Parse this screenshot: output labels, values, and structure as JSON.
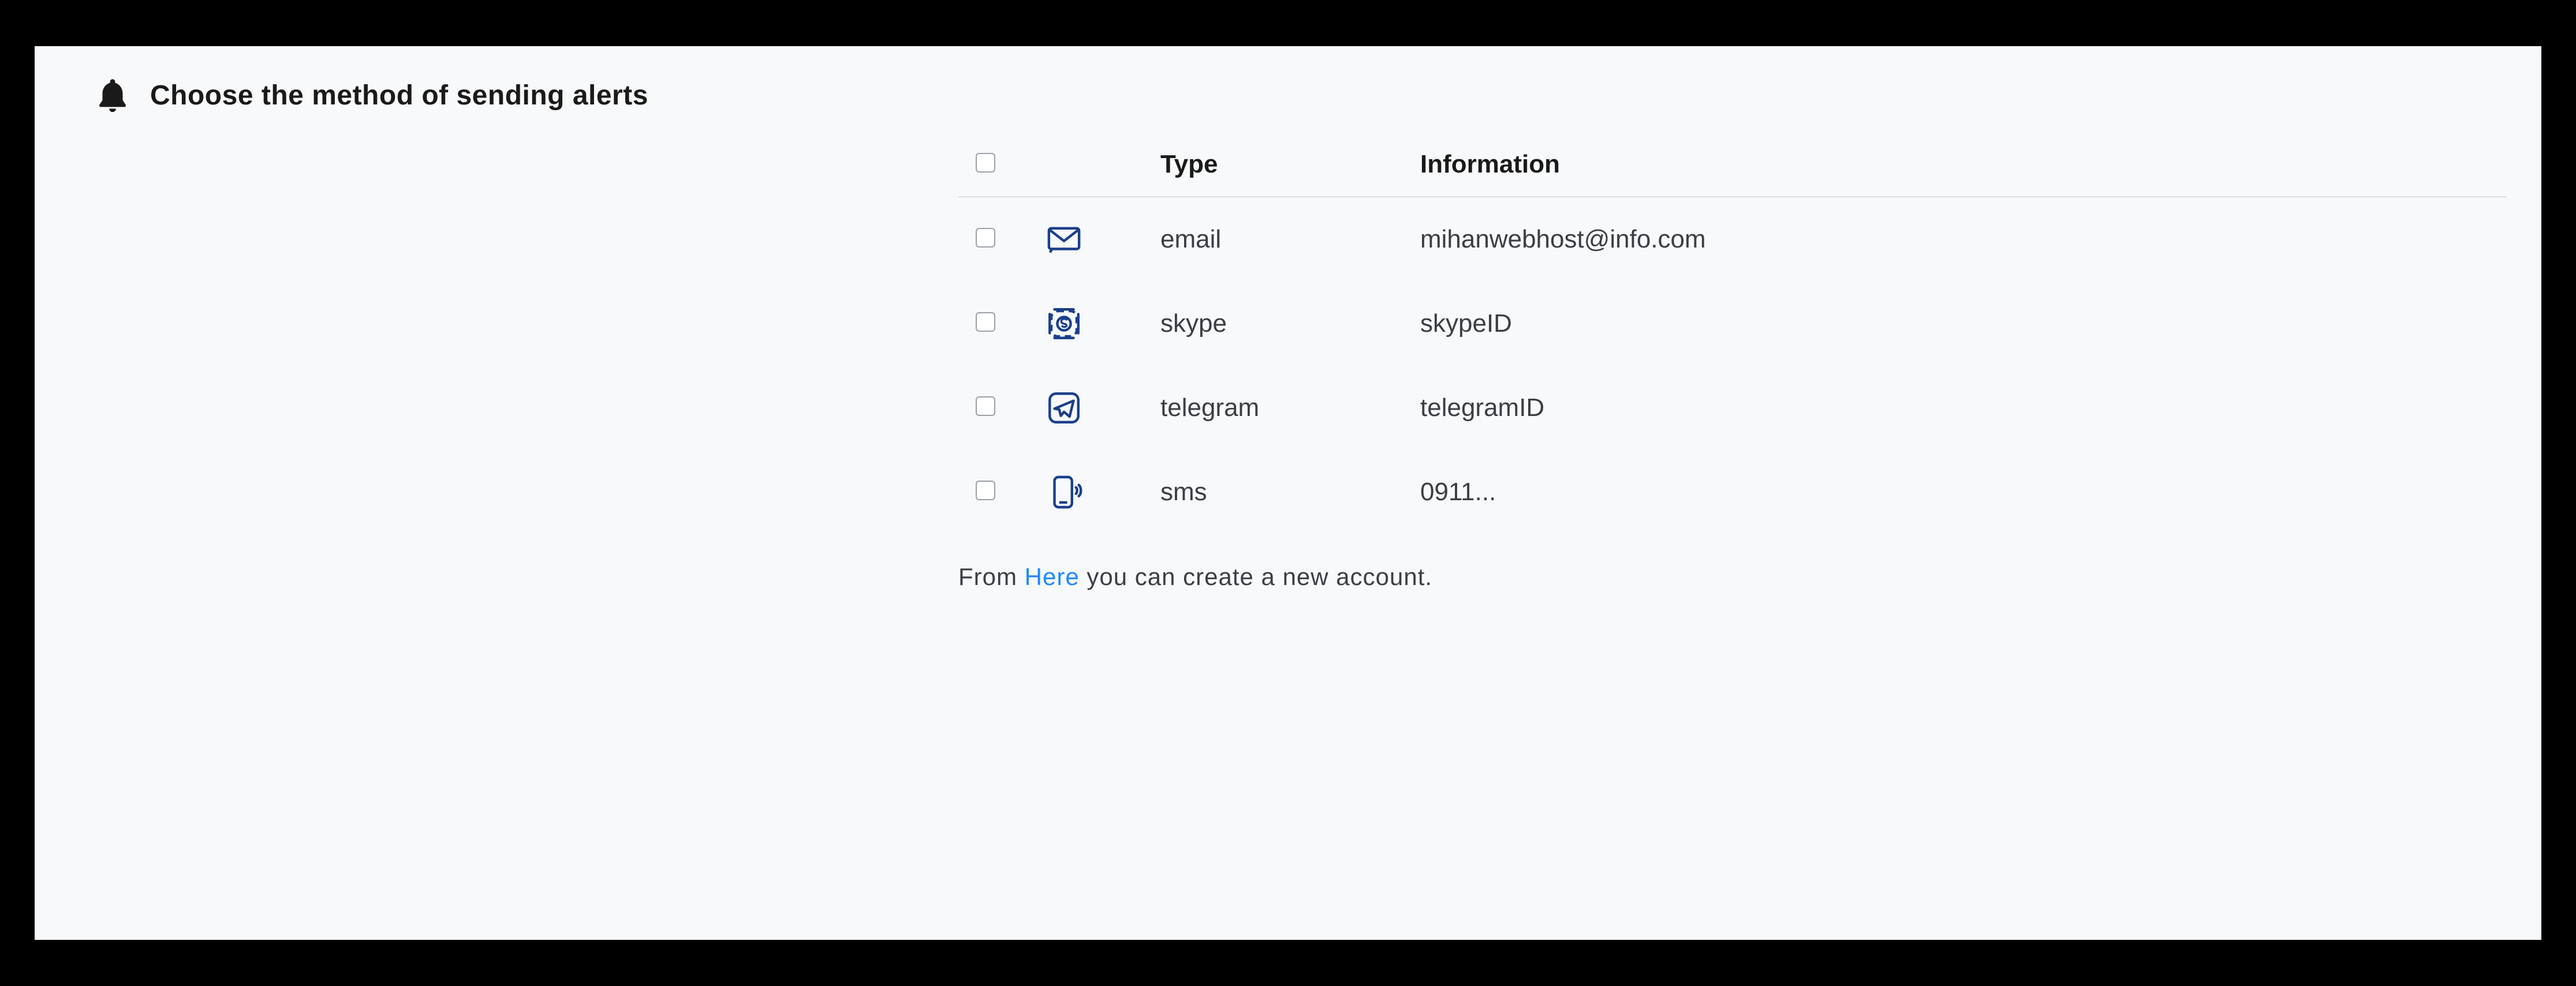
{
  "header": {
    "title": "Choose the method of sending alerts"
  },
  "table": {
    "headers": {
      "type": "Type",
      "info": "Information"
    },
    "rows": [
      {
        "icon": "email-icon",
        "type": "email",
        "info": "mihanwebhost@info.com"
      },
      {
        "icon": "skype-icon",
        "type": "skype",
        "info": "skypeID"
      },
      {
        "icon": "telegram-icon",
        "type": "telegram",
        "info": "telegramID"
      },
      {
        "icon": "sms-icon",
        "type": "sms",
        "info": "0911..."
      }
    ]
  },
  "footer": {
    "prefix": "From ",
    "link": "Here",
    "suffix": " you can create a new account."
  }
}
